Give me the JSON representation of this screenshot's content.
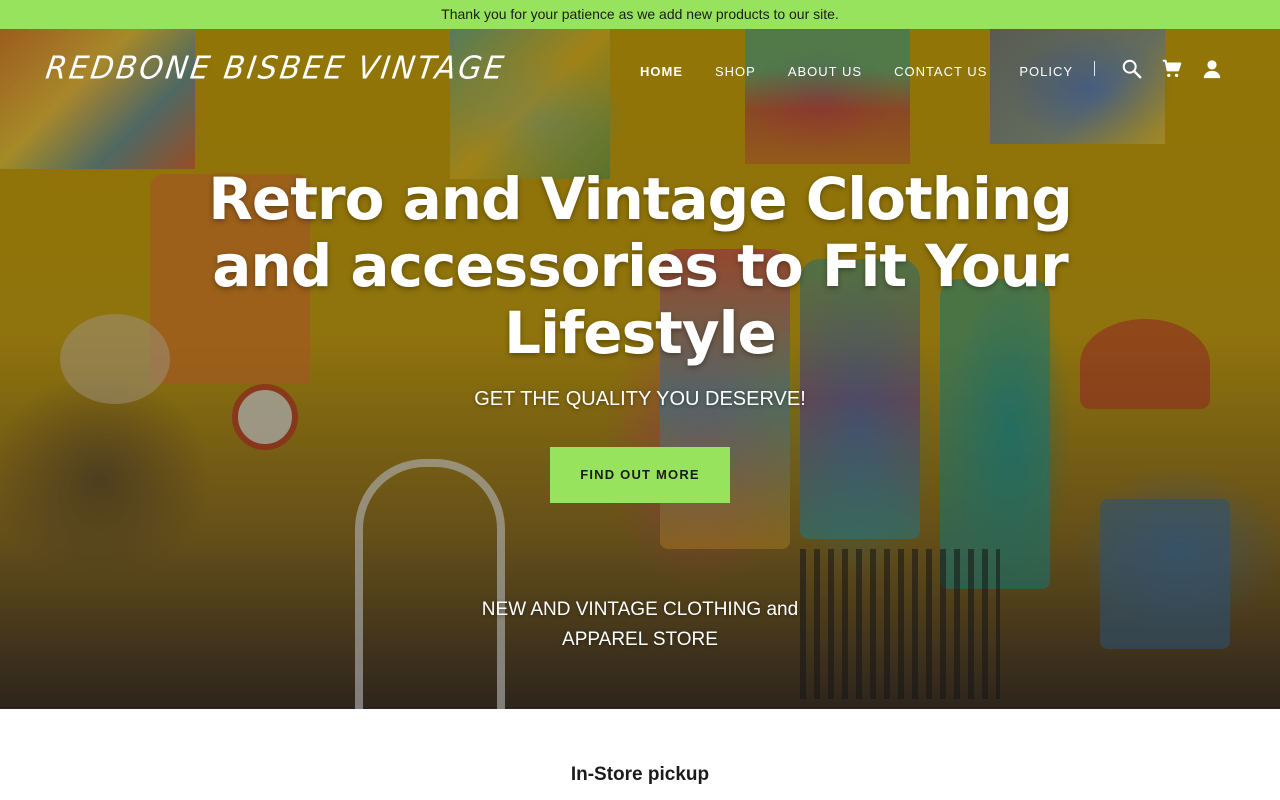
{
  "announcement": {
    "text": "Thank you for your patience as we add new products to our site."
  },
  "brand": {
    "logo_text": "REDBONE BISBEE VINTAGE"
  },
  "nav": {
    "items": [
      {
        "label": "HOME",
        "active": true
      },
      {
        "label": "SHOP",
        "active": false
      },
      {
        "label": "ABOUT US",
        "active": false
      },
      {
        "label": "CONTACT US",
        "active": false
      },
      {
        "label": "POLICY",
        "active": false
      }
    ],
    "icons": [
      "search-icon",
      "cart-icon",
      "account-icon"
    ]
  },
  "hero": {
    "title": "Retro and Vintage Clothing and accessories to Fit Your Lifestyle",
    "subtitle": "GET THE QUALITY YOU DESERVE!",
    "cta_label": "FIND OUT MORE",
    "store_line1": "NEW AND VINTAGE CLOTHING and",
    "store_line2": "APPAREL STORE"
  },
  "section": {
    "heading": "In-Store pickup"
  },
  "colors": {
    "accent": "#97e35d",
    "text": "#1b1b1b",
    "hero_text": "#ffffff"
  }
}
